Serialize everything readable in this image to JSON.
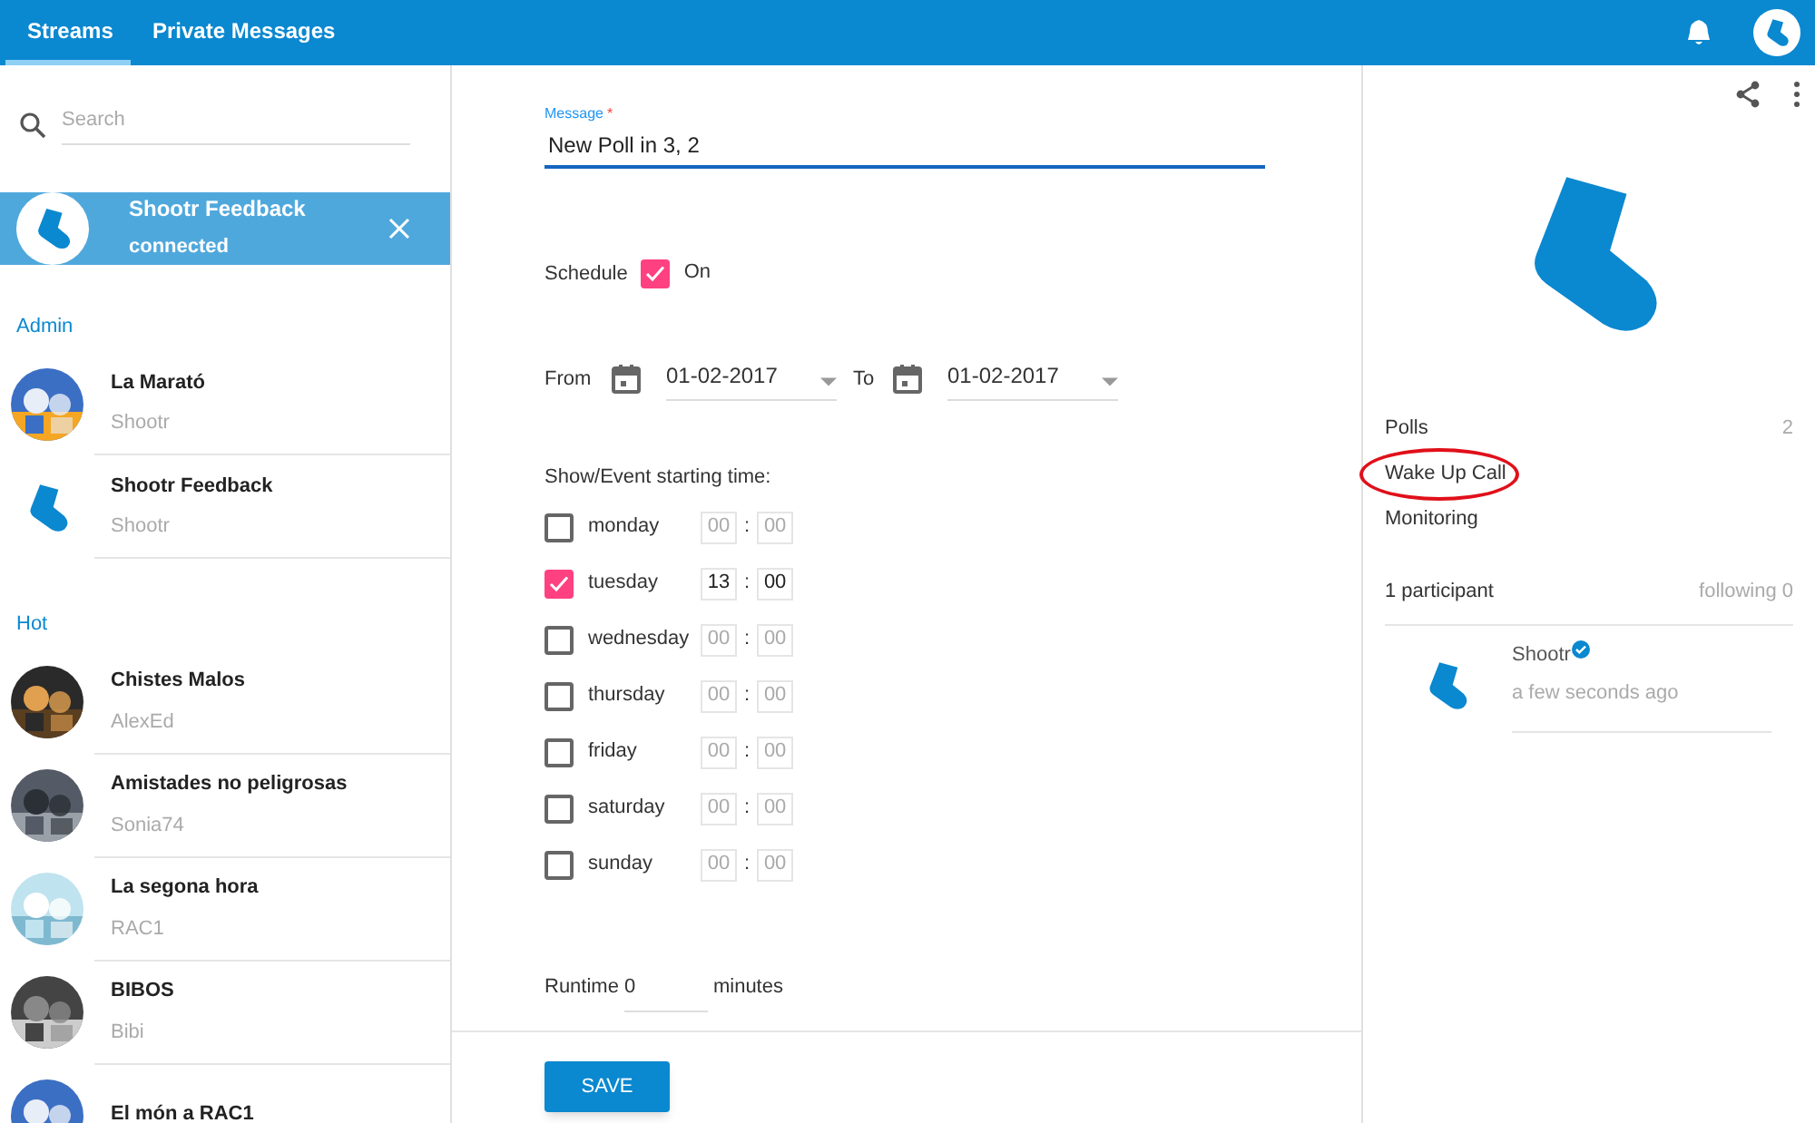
{
  "top_bar": {
    "tabs": [
      {
        "label": "Streams",
        "selected": true
      },
      {
        "label": "Private Messages",
        "selected": false
      }
    ]
  },
  "sidebar": {
    "search": {
      "placeholder": "Search"
    },
    "connected": {
      "title": "Shootr Feedback",
      "status": "connected"
    },
    "sections": [
      {
        "heading": "Admin",
        "items": [
          {
            "title": "La Marató",
            "subtitle": "Shootr",
            "kind": "picture"
          },
          {
            "title": "Shootr Feedback",
            "subtitle": "Shootr",
            "kind": "sock"
          }
        ]
      },
      {
        "heading": "Hot",
        "items": [
          {
            "title": "Chistes Malos",
            "subtitle": "AlexEd",
            "kind": "picture"
          },
          {
            "title": "Amistades no peligrosas",
            "subtitle": "Sonia74",
            "kind": "picture"
          },
          {
            "title": "La segona hora",
            "subtitle": "RAC1",
            "kind": "picture"
          },
          {
            "title": "BIBOS",
            "subtitle": "Bibi",
            "kind": "picture"
          },
          {
            "title": "El món a RAC1",
            "kind": "picture"
          }
        ]
      }
    ]
  },
  "form": {
    "message": {
      "label": "Message",
      "required_mark": "*",
      "value": "New Poll in 3, 2"
    },
    "schedule": {
      "label": "Schedule",
      "checked": true,
      "state_label": "On"
    },
    "dates": {
      "from_label": "From",
      "from": "01-02-2017",
      "to_label": "To",
      "to": "01-02-2017"
    },
    "days_heading": "Show/Event starting time:",
    "days": [
      {
        "label": "monday",
        "checked": false,
        "hour": "00",
        "separator": ":",
        "minute": "00"
      },
      {
        "label": "tuesday",
        "checked": true,
        "hour": "13",
        "separator": ":",
        "minute": "00"
      },
      {
        "label": "wednesday",
        "checked": false,
        "hour": "00",
        "separator": ":",
        "minute": "00"
      },
      {
        "label": "thursday",
        "checked": false,
        "hour": "00",
        "separator": ":",
        "minute": "00"
      },
      {
        "label": "friday",
        "checked": false,
        "hour": "00",
        "separator": ":",
        "minute": "00"
      },
      {
        "label": "saturday",
        "checked": false,
        "hour": "00",
        "separator": ":",
        "minute": "00"
      },
      {
        "label": "sunday",
        "checked": false,
        "hour": "00",
        "separator": ":",
        "minute": "00"
      }
    ],
    "runtime": {
      "label": "Runtime",
      "value": "0",
      "unit": "minutes"
    },
    "save": "SAVE"
  },
  "details": {
    "stats": [
      {
        "label": "Polls",
        "count": "2",
        "circled": false
      },
      {
        "label": "Wake Up Call",
        "circled": true
      },
      {
        "label": "Monitoring",
        "circled": false
      }
    ],
    "participants": "1 participant",
    "following": "following 0",
    "members": [
      {
        "name": "Shootr",
        "verified": true,
        "time": "a few seconds ago"
      }
    ]
  }
}
